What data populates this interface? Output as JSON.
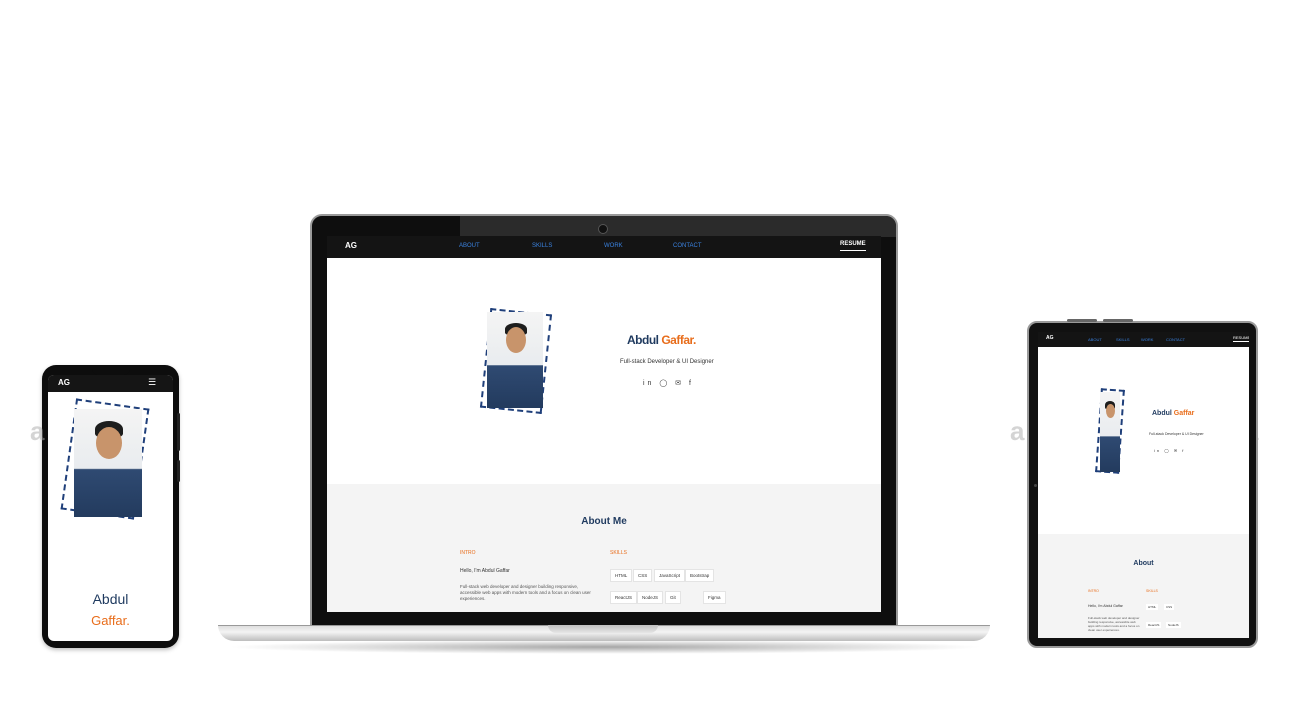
{
  "site": {
    "logo": "AG",
    "menu_icon": "hamburger-icon",
    "nav_links": [
      "ABOUT",
      "SKILLS",
      "WORK",
      "CONTACT"
    ],
    "resume_label": "RESUME"
  },
  "hero": {
    "first_name": "Abdul",
    "last_name": "Gaffar.",
    "role": "Full-stack Developer & UI Designer",
    "social_icons": [
      "github-icon",
      "linkedin-icon",
      "twitter-icon",
      "facebook-icon"
    ],
    "social_glyphs": "in ◯ ✉ f"
  },
  "about": {
    "title": "About Me",
    "intro_heading": "INTRO",
    "skills_heading": "SKILLS",
    "intro_line": "Hello, I'm Abdul Gaffar",
    "bio": "Full-stack web developer and designer building responsive, accessible web apps with modern tools and a focus on clean user experiences.",
    "skills": [
      "HTML",
      "CSS",
      "JavaScript",
      "Bootstrap",
      "ReactJS",
      "NodeJS",
      "Git",
      "Figma"
    ]
  },
  "tablet": {
    "name_short_first": "Abdul",
    "name_short_last": "Gaffar",
    "about_title": "About"
  },
  "watermark": "a",
  "colors": {
    "navy": "#1f3a5f",
    "accent": "#e86d1b",
    "nav_link": "#3a82e0",
    "nav_bg": "#141414"
  }
}
